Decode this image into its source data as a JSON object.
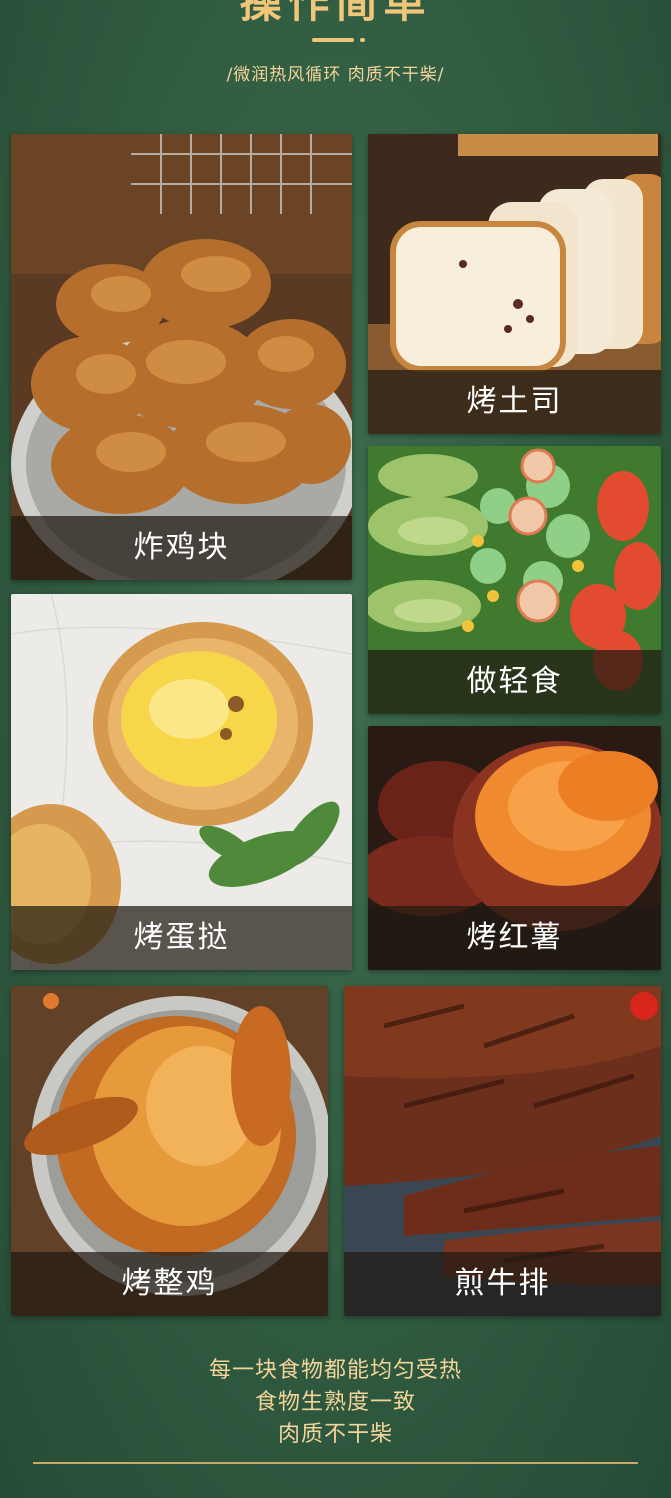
{
  "header": {
    "title": "操作简单",
    "subtitle": "/微润热风循环 肉质不干柴/"
  },
  "items": [
    {
      "label": "炸鸡块",
      "icon": "fried-chicken-photo"
    },
    {
      "label": "烤土司",
      "icon": "toast-photo"
    },
    {
      "label": "做轻食",
      "icon": "salad-photo"
    },
    {
      "label": "烤蛋挞",
      "icon": "egg-tart-photo"
    },
    {
      "label": "烤红薯",
      "icon": "sweet-potato-photo"
    },
    {
      "label": "烤整鸡",
      "icon": "roast-chicken-photo"
    },
    {
      "label": "煎牛排",
      "icon": "steak-photo"
    }
  ],
  "footer": {
    "line1": "每一块食物都能均匀受热",
    "line2": "食物生熟度一致",
    "line3": "肉质不干柴"
  },
  "colors": {
    "background": "#2f5b40",
    "accent_gold": "#f1c67a",
    "label_overlay": "#201a12"
  }
}
